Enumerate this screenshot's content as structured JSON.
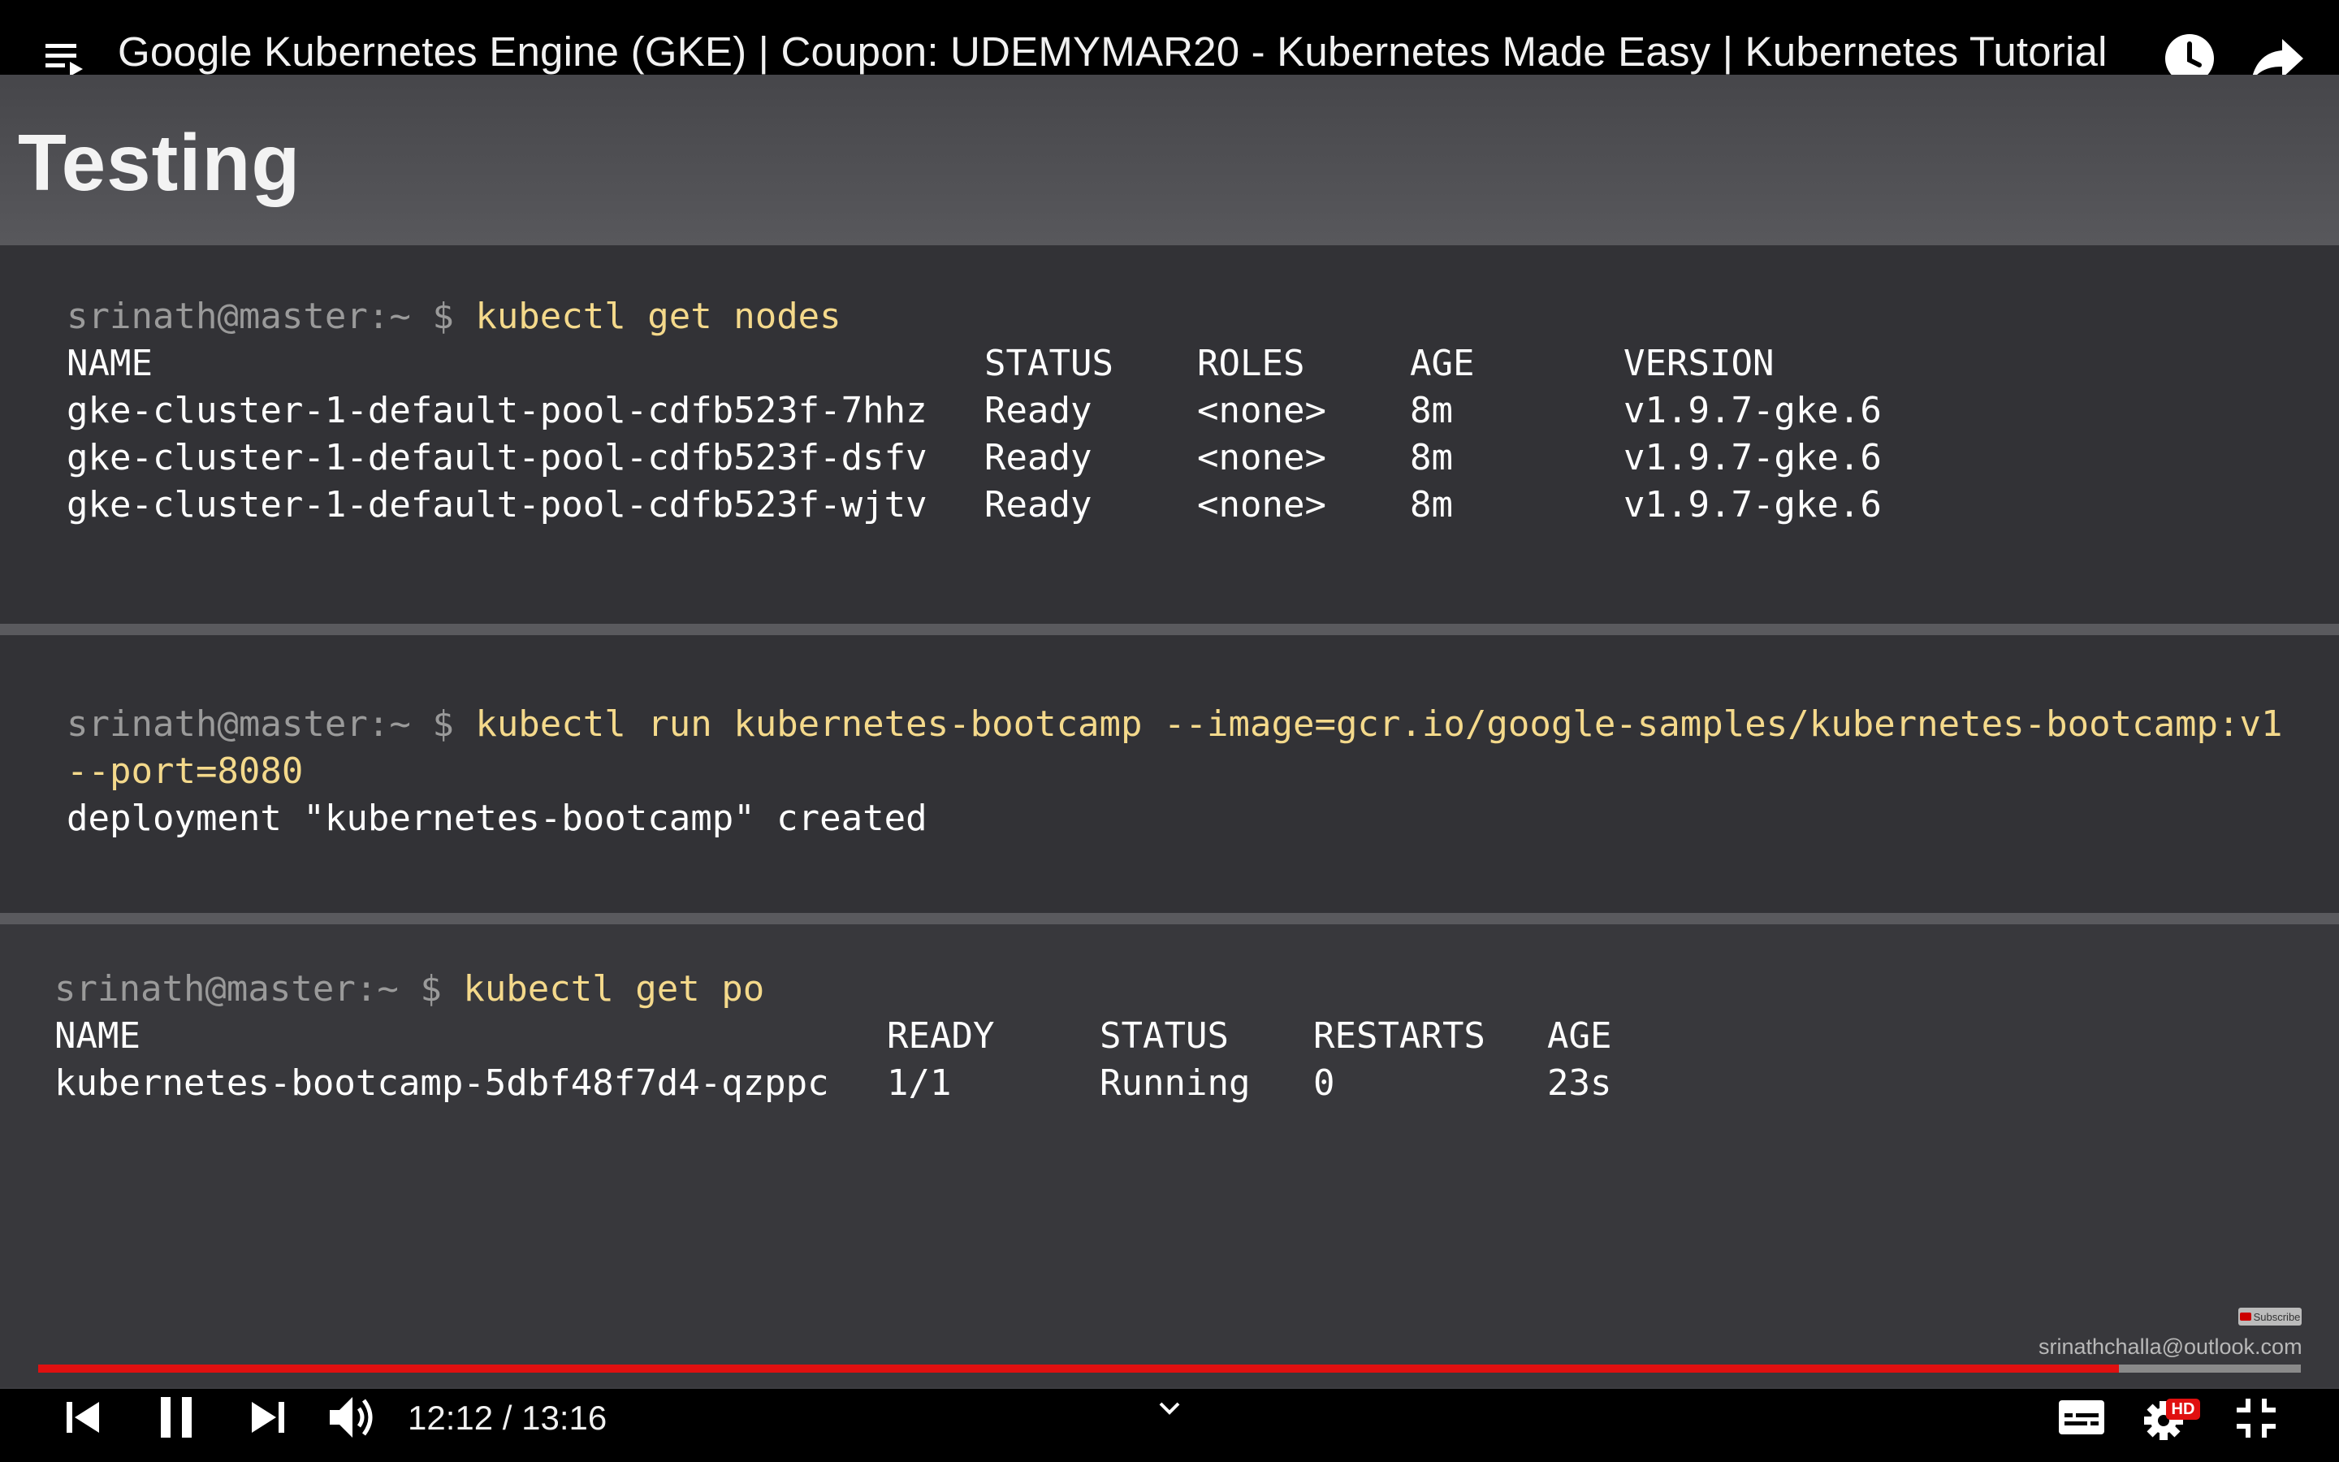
{
  "player": {
    "title": "Google Kubernetes Engine (GKE) | Coupon: UDEMYMAR20 - Kubernetes Made Easy | Kubernetes Tutorial",
    "current_time": "12:12",
    "duration": "13:16",
    "time_display": "12:12 / 13:16",
    "progress_fraction": 0.9196,
    "quality_badge": "HD",
    "colors": {
      "progress": "#e01010",
      "background": "#000000"
    },
    "icons": [
      "playlist-icon",
      "watch-later-icon",
      "share-icon",
      "previous-icon",
      "pause-icon",
      "next-icon",
      "volume-icon",
      "chevron-down-icon",
      "subtitles-icon",
      "settings-icon",
      "exit-fullscreen-icon"
    ]
  },
  "slide": {
    "title": "Testing",
    "watermark_email": "srinathchalla@outlook.com",
    "subscribe_label": "Subscribe",
    "panel1": {
      "prompt": "srinath@master:~ $",
      "command": "kubectl get nodes",
      "headers": [
        "NAME",
        "STATUS",
        "ROLES",
        "AGE",
        "VERSION"
      ],
      "rows": [
        [
          "gke-cluster-1-default-pool-cdfb523f-7hhz",
          "Ready",
          "<none>",
          "8m",
          "v1.9.7-gke.6"
        ],
        [
          "gke-cluster-1-default-pool-cdfb523f-dsfv",
          "Ready",
          "<none>",
          "8m",
          "v1.9.7-gke.6"
        ],
        [
          "gke-cluster-1-default-pool-cdfb523f-wjtv",
          "Ready",
          "<none>",
          "8m",
          "v1.9.7-gke.6"
        ]
      ]
    },
    "panel2": {
      "prompt": "srinath@master:~ $",
      "command_line1": "kubectl run kubernetes-bootcamp --image=gcr.io/google-samples/kubernetes-bootcamp:v1",
      "command_line2": "--port=8080",
      "output": "deployment \"kubernetes-bootcamp\" created"
    },
    "panel3": {
      "prompt": "srinath@master:~ $",
      "command": "kubectl get po",
      "headers": [
        "NAME",
        "READY",
        "STATUS",
        "RESTARTS",
        "AGE"
      ],
      "rows": [
        [
          "kubernetes-bootcamp-5dbf48f7d4-qzppc",
          "1/1",
          "Running",
          "0",
          "23s"
        ]
      ]
    }
  }
}
